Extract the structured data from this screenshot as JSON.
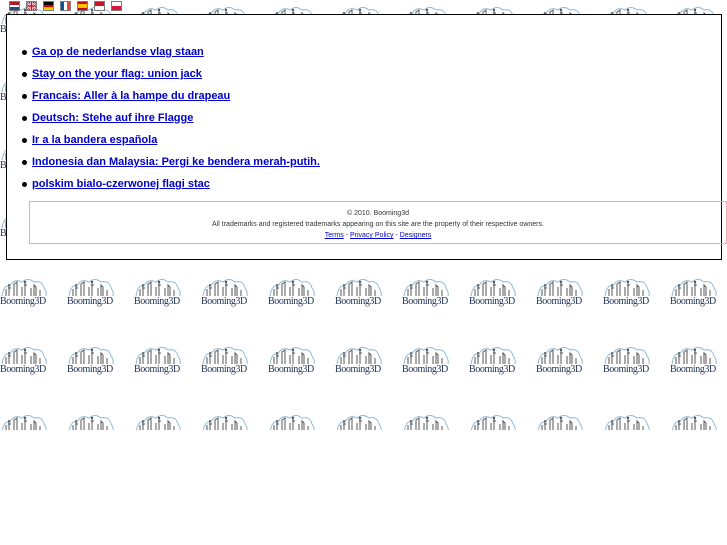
{
  "flags": [
    {
      "icon": "dutch-flag-icon",
      "colors": [
        "#ae1c28",
        "#ffffff",
        "#21468b"
      ]
    },
    {
      "icon": "uk-flag-icon",
      "colors": [
        "#012169",
        "#ffffff",
        "#c8102e"
      ]
    },
    {
      "icon": "german-flag-icon",
      "colors": [
        "#000000",
        "#dd0000",
        "#ffce00"
      ]
    },
    {
      "icon": "french-flag-icon",
      "colors": [
        "#0055a4",
        "#ffffff",
        "#ef4135"
      ]
    },
    {
      "icon": "spanish-flag-icon",
      "colors": [
        "#c60b1e",
        "#ffc400",
        "#c60b1e"
      ]
    },
    {
      "icon": "indonesian-flag-icon",
      "colors": [
        "#ce1126",
        "#ffffff"
      ]
    },
    {
      "icon": "polish-flag-icon",
      "colors": [
        "#ffffff",
        "#dc143c"
      ]
    }
  ],
  "links": [
    "Ga op de nederlandse vlag staan",
    "Stay on the your flag: union jack",
    "Francais: Aller à la hampe du drapeau",
    "Deutsch: Stehe auf ihre Flagge",
    "Ir a la bandera española",
    "Indonesia dan Malaysia: Pergi ke bendera merah-putih.",
    "polskim bialo-czerwonej flagi stac"
  ],
  "footer": {
    "copyright": "© 2010. Booming3d",
    "trademark": "All trademarks and registered trademarks appearing on this site are the property of their respective owners.",
    "terms": "Terms",
    "sep1": " - ",
    "privacy": "Privacy Policy",
    "sep2": " - ",
    "designers": "Designers"
  },
  "tile": {
    "logo_text": "Booming3D",
    "icon": "booming3d-logo-icon",
    "colors": {
      "outline": "#8db8d6",
      "figure": "#555555",
      "text": "#1c2f55"
    }
  },
  "colors": {
    "link": "#0000cc",
    "footer_border": "#f0a8b4",
    "box_border": "#000000"
  }
}
